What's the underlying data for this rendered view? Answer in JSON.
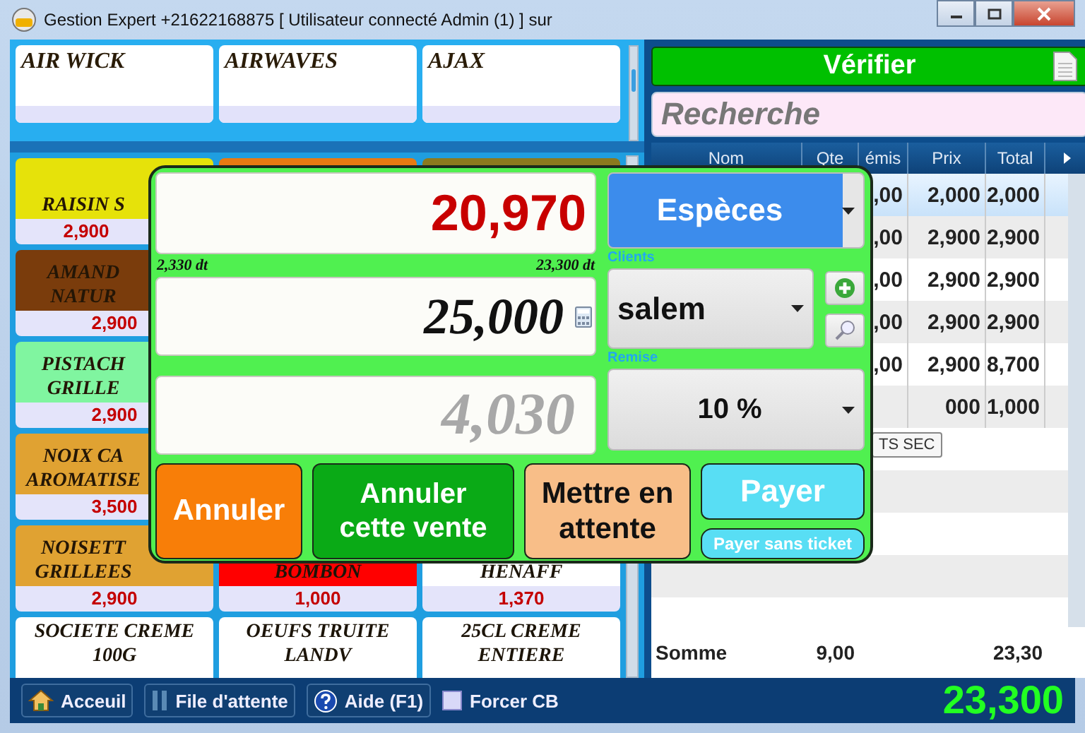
{
  "window": {
    "title": "Gestion Expert +21622168875 [ Utilisateur connecté Admin (1) ] sur"
  },
  "brands": [
    "AIR WICK",
    "AIRWAVES",
    "AJAX"
  ],
  "products": [
    [
      {
        "name": "RAISIN S",
        "price": "2,900",
        "color": "#e6e20a"
      },
      {
        "color": "#e87a12"
      },
      {
        "color": "#8c7a1e"
      }
    ],
    [
      {
        "name": "AMAND\nNATUR",
        "price": "2,900",
        "color": "#7a3c0c"
      }
    ],
    [
      {
        "name": "PISTACH\nGRILLE",
        "price": "2,900",
        "color": "#80f5a0"
      }
    ],
    [
      {
        "name": "NOIX CA\nAROMATISE",
        "price": "3,500",
        "color": "#e0a232"
      }
    ],
    [
      {
        "name": "NOISETT\nGRILLEES",
        "price": "2,900",
        "color": "#e0a232"
      },
      {
        "name": "BOMBON",
        "price": "1,000",
        "color": "#ff0000"
      },
      {
        "name": "HENAFF",
        "price": "1,370",
        "color": "#ffffff"
      }
    ],
    [
      {
        "name": "SOCIETE CREME\n100G",
        "color": "#ffffff"
      },
      {
        "name": "OEUFS TRUITE\nLANDV",
        "color": "#ffffff"
      },
      {
        "name": "25CL CREME\nENTIERE",
        "color": "#ffffff"
      }
    ]
  ],
  "verify_button": "Vérifier",
  "search": {
    "placeholder": "Recherche"
  },
  "table": {
    "columns": [
      "Nom",
      "Qte",
      "émis",
      "Prix",
      "Total"
    ],
    "rows": [
      {
        "emis": ",00",
        "prix": "2,000",
        "total": "2,000",
        "selected": true
      },
      {
        "emis": ",00",
        "prix": "2,900",
        "total": "2,900",
        "selected": false
      },
      {
        "emis": ",00",
        "prix": "2,900",
        "total": "2,900",
        "selected": false
      },
      {
        "emis": ",00",
        "prix": "2,900",
        "total": "2,900",
        "selected": false
      },
      {
        "emis": ",00",
        "prix": "2,900",
        "total": "8,700",
        "selected": false
      },
      {
        "prix": "000",
        "total": "1,000",
        "selected": false
      }
    ],
    "footer": {
      "label": "Somme",
      "qte": "9,00",
      "total": "23,30"
    }
  },
  "tooltip": "TS SEC",
  "dialog": {
    "amount_due": "20,970",
    "left_note": "2,330 dt",
    "right_note": "23,300 dt",
    "given": "25,000",
    "change": "4,030",
    "payment_method": "Espèces",
    "clients_label": "Clients",
    "client": "salem",
    "discount_label": "Remise",
    "discount": "10 %",
    "buttons": [
      {
        "label": "Annuler",
        "kind": "cancel"
      },
      {
        "label": "Annuler cette vente",
        "kind": "void"
      },
      {
        "label": "Mettre en attente",
        "kind": "hold"
      },
      {
        "label": "Payer",
        "kind": "pay"
      },
      {
        "label": "Payer sans ticket",
        "kind": "pay-no-ticket"
      }
    ]
  },
  "bottom_bar": {
    "buttons": [
      {
        "label": "Acceuil",
        "kind": "home"
      },
      {
        "label": "File d'attente",
        "kind": "queue"
      },
      {
        "label": "Aide (F1)",
        "kind": "help"
      }
    ],
    "force_cb": {
      "label": "Forcer CB",
      "checked": false
    },
    "total": "23,300"
  }
}
